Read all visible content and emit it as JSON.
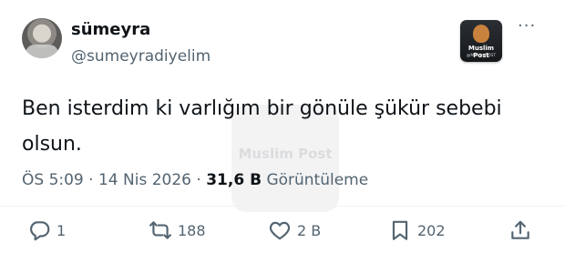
{
  "author": {
    "display_name": "sümeyra",
    "handle": "@sumeyradiyelim"
  },
  "badge": {
    "title": "Muslim Post",
    "subtitle": "@MuslimPOST"
  },
  "watermark": {
    "text": "Muslim Post"
  },
  "tweet": {
    "line1": "Ben isterdim ki varlığım bir gönüle şükür sebebi",
    "line2": "olsun."
  },
  "meta": {
    "time": "ÖS 5:09",
    "dot": "·",
    "date": "14 Nis 2026",
    "views_count": "31,6 B",
    "views_label": "Görüntüleme"
  },
  "actions": {
    "reply_count": "1",
    "retweet_count": "188",
    "like_count": "2 B",
    "bookmark_count": "202"
  },
  "icons": {
    "more": "more-icon",
    "reply": "reply-icon",
    "retweet": "retweet-icon",
    "like": "like-icon",
    "bookmark": "bookmark-icon",
    "share": "share-icon"
  }
}
